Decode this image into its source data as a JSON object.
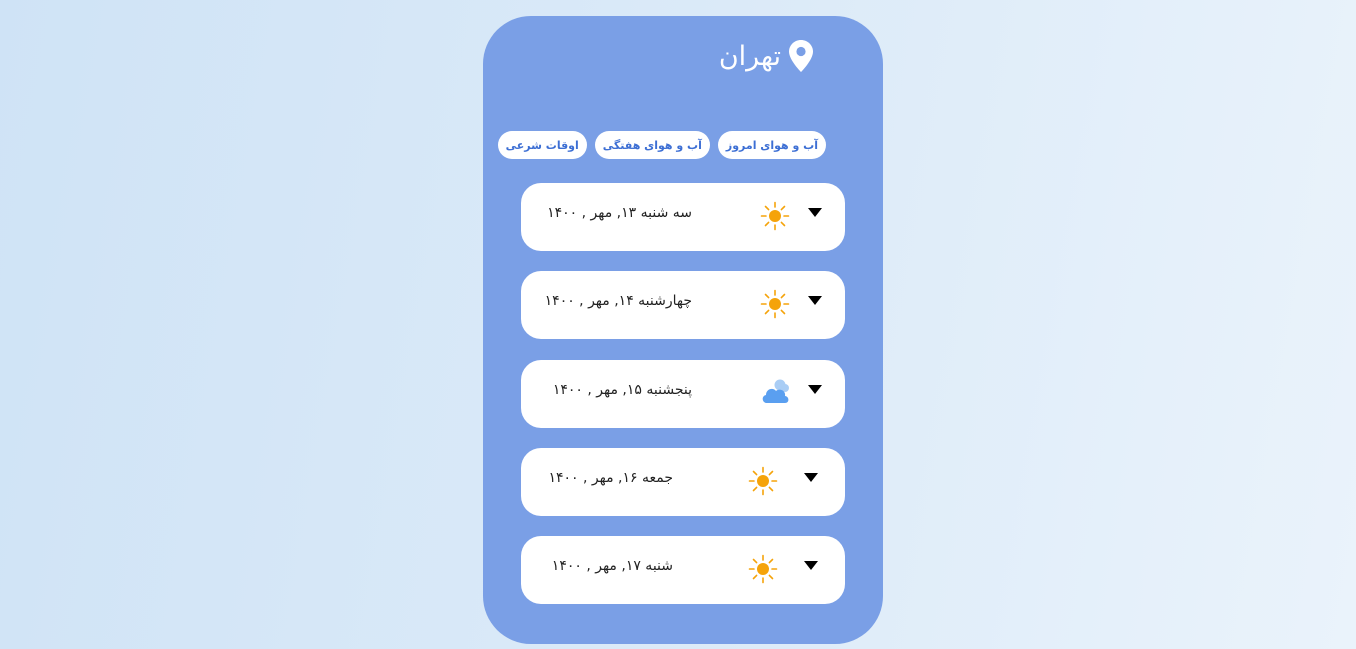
{
  "city": {
    "name": "تهران",
    "icon": "location-pin-icon"
  },
  "tabs": [
    {
      "label": "آب و هوای امروز"
    },
    {
      "label": "آب و هوای هفتگی"
    },
    {
      "label": "اوقات شرعی"
    }
  ],
  "days": [
    {
      "label": "سه شنبه ۱۳, مهر , ۱۴۰۰",
      "icon": "sun-icon"
    },
    {
      "label": "چهارشنبه ۱۴, مهر , ۱۴۰۰",
      "icon": "sun-icon"
    },
    {
      "label": "پنجشنبه ۱۵, مهر , ۱۴۰۰",
      "icon": "cloud-icon"
    },
    {
      "label": "جمعه ۱۶, مهر , ۱۴۰۰",
      "icon": "sun-icon"
    },
    {
      "label": "شنبه ۱۷, مهر , ۱۴۰۰",
      "icon": "sun-icon"
    }
  ],
  "colors": {
    "background": "#d6e8f7",
    "panel": "#7a9fe6",
    "tab_text": "#3d6fd4",
    "sun": "#f5a30a",
    "cloud": "#5a9ff0"
  }
}
